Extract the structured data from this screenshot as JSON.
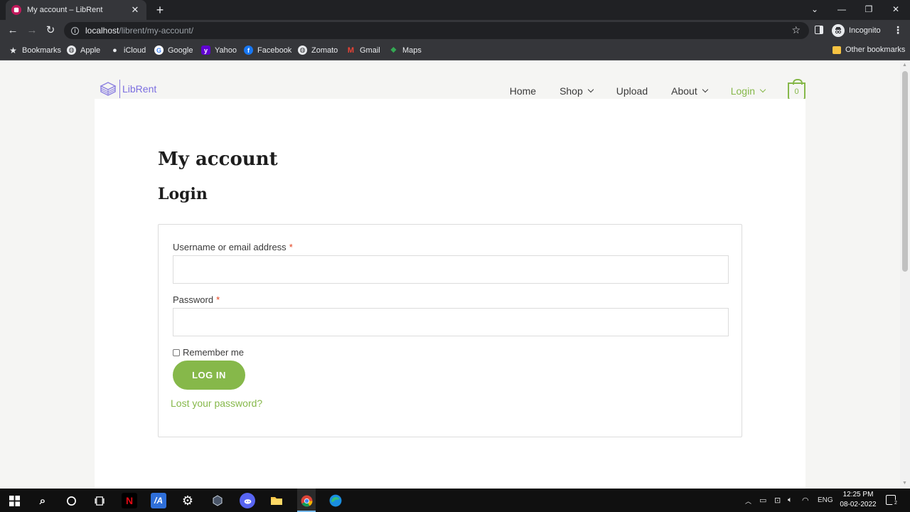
{
  "browser": {
    "tab_title": "My account – LibRent",
    "tab_close": "✕",
    "new_tab": "+",
    "url_host": "localhost",
    "url_path": "/librent/my-account/",
    "incognito_label": "Incognito",
    "window_controls": {
      "tab_search": "⌄",
      "minimize": "—",
      "restore": "❐",
      "close": "✕"
    }
  },
  "bookmarks": {
    "items": [
      {
        "label": "Bookmarks",
        "icon": "star-icon",
        "color": "#e8eaed"
      },
      {
        "label": "Apple",
        "icon": "globe-icon",
        "color": "#e8eaed"
      },
      {
        "label": "iCloud",
        "icon": "apple-icon",
        "color": "#e8eaed"
      },
      {
        "label": "Google",
        "icon": "google-icon",
        "color": "#ffffff"
      },
      {
        "label": "Yahoo",
        "icon": "yahoo-icon",
        "color": "#6001d2"
      },
      {
        "label": "Facebook",
        "icon": "facebook-icon",
        "color": "#1877f2"
      },
      {
        "label": "Zomato",
        "icon": "globe-icon",
        "color": "#e8eaed"
      },
      {
        "label": "Gmail",
        "icon": "gmail-icon",
        "color": "#ea4335"
      },
      {
        "label": "Maps",
        "icon": "maps-icon",
        "color": "#34a853"
      }
    ],
    "other": "Other bookmarks"
  },
  "site": {
    "logo_text": "LibRent",
    "nav": {
      "home": "Home",
      "shop": "Shop",
      "upload": "Upload",
      "about": "About",
      "login": "Login"
    },
    "cart_count": "0",
    "accent_color": "#86b84a",
    "logo_color": "#7b6ee0"
  },
  "page": {
    "title": "My account",
    "section_title": "Login",
    "form": {
      "username_label": "Username or email address",
      "password_label": "Password",
      "required_mark": "*",
      "username_value": "",
      "password_value": "",
      "remember_label": "Remember me",
      "remember_checked": false,
      "submit_label": "LOG IN",
      "lost_password": "Lost your password?"
    }
  },
  "taskbar": {
    "language": "ENG",
    "time": "12:25 PM",
    "date": "08-02-2022",
    "notification_count": "2"
  }
}
